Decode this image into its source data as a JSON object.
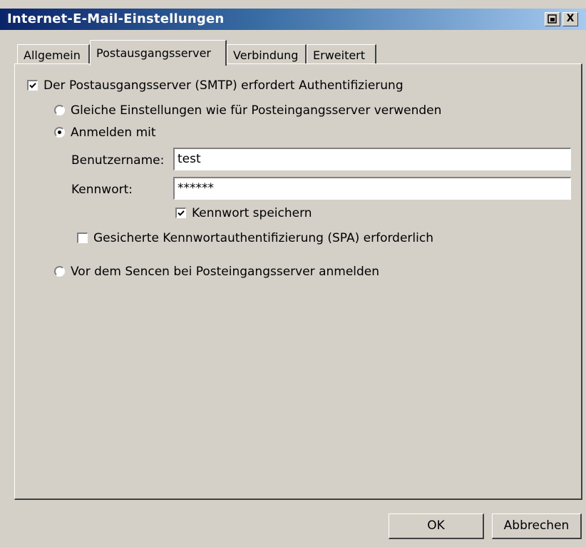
{
  "window": {
    "title": "Internet-E-Mail-Einstellungen",
    "help_button": "?",
    "close_button": "X"
  },
  "tabs": [
    {
      "label": "Allgemein",
      "active": false
    },
    {
      "label": "Postausgangsserver",
      "active": true
    },
    {
      "label": "Verbindung",
      "active": false
    },
    {
      "label": "Erweitert",
      "active": false
    }
  ],
  "smtp_auth": {
    "label": "Der Postausgangsserver (SMTP) erfordert Authentifizierung",
    "checked": true
  },
  "options": {
    "same_settings": {
      "label": "Gleiche Einstellungen wie für Posteingangsserver verwenden",
      "selected": false
    },
    "login_with": {
      "label": "Anmelden mit",
      "selected": true
    },
    "login_before_send": {
      "label": "Vor dem Sencen bei Posteingangsserver anmelden",
      "selected": false
    }
  },
  "credentials": {
    "username_label": "Benutzername:",
    "username_value": "test",
    "password_label": "Kennwort:",
    "password_value": "******",
    "save_password": {
      "label": "Kennwort speichern",
      "checked": true
    },
    "spa": {
      "label": "Gesicherte Kennwortauthentifizierung (SPA) erforderlich",
      "checked": false
    }
  },
  "buttons": {
    "ok": "OK",
    "cancel": "Abbrechen"
  }
}
